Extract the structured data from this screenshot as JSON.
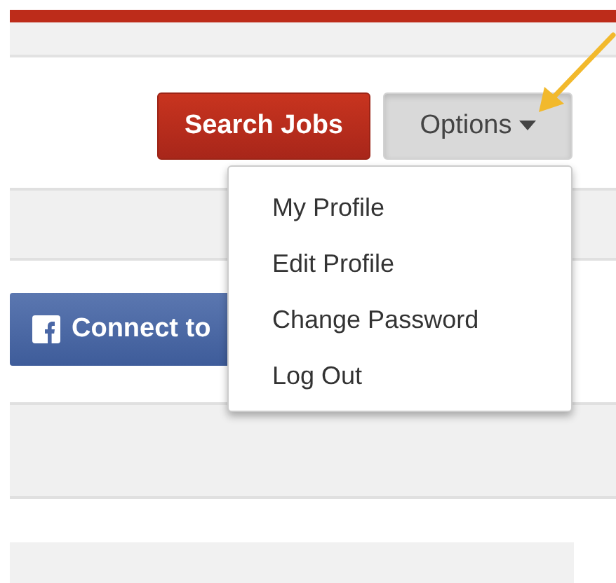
{
  "header_buttons": [
    {
      "label": "Search Jobs",
      "kind": "primary"
    },
    {
      "label": "Options",
      "kind": "dropdown",
      "expanded": true
    }
  ],
  "options_menu": {
    "items": [
      "My Profile",
      "Edit Profile",
      "Change Password",
      "Log Out"
    ]
  },
  "facebook_button": {
    "label": "Connect to"
  }
}
